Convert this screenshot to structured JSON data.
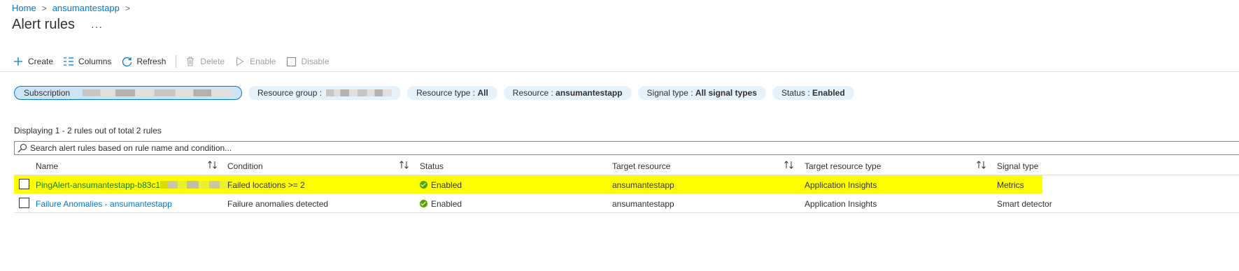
{
  "breadcrumb": {
    "home": "Home",
    "resource": "ansumantestapp",
    "sep": ">"
  },
  "page": {
    "title": "Alert rules",
    "more": "···"
  },
  "toolbar": {
    "create": "Create",
    "columns": "Columns",
    "refresh": "Refresh",
    "delete": "Delete",
    "enable": "Enable",
    "disable": "Disable"
  },
  "filters": {
    "subscription_label": "Subscription",
    "resource_group_label": "Resource group :",
    "resource_type_label": "Resource type :",
    "resource_type_value": "All",
    "resource_label": "Resource :",
    "resource_value": "ansumantestapp",
    "signal_type_label": "Signal type :",
    "signal_type_value": "All signal types",
    "status_label": "Status :",
    "status_value": "Enabled"
  },
  "summary": "Displaying 1 - 2 rules out of total 2 rules",
  "search": {
    "placeholder": "Search alert rules based on rule name and condition..."
  },
  "table": {
    "headers": {
      "name": "Name",
      "condition": "Condition",
      "status": "Status",
      "target_resource": "Target resource",
      "target_resource_type": "Target resource type",
      "signal_type": "Signal type"
    },
    "rows": [
      {
        "name": "PingAlert-ansumantestapp-b83c1",
        "name_suffix": "...",
        "condition": "Failed locations >= 2",
        "status": "Enabled",
        "target_resource": "ansumantestapp",
        "target_resource_type": "Application Insights",
        "signal_type": "Metrics"
      },
      {
        "name": "Failure Anomalies - ansumantestapp",
        "condition": "Failure anomalies detected",
        "status": "Enabled",
        "target_resource": "ansumantestapp",
        "target_resource_type": "Application Insights",
        "signal_type": "Smart detector"
      }
    ]
  },
  "colors": {
    "accent": "#0078d4",
    "highlight": "#ffff00",
    "status_ok": "#57a300",
    "pill_bg": "#e5f1fb"
  },
  "icons": [
    "plus-icon",
    "columns-icon",
    "refresh-icon",
    "delete-icon",
    "enable-icon",
    "disable-icon",
    "search-icon",
    "sort-icon",
    "status-enabled-icon",
    "more-icon"
  ]
}
